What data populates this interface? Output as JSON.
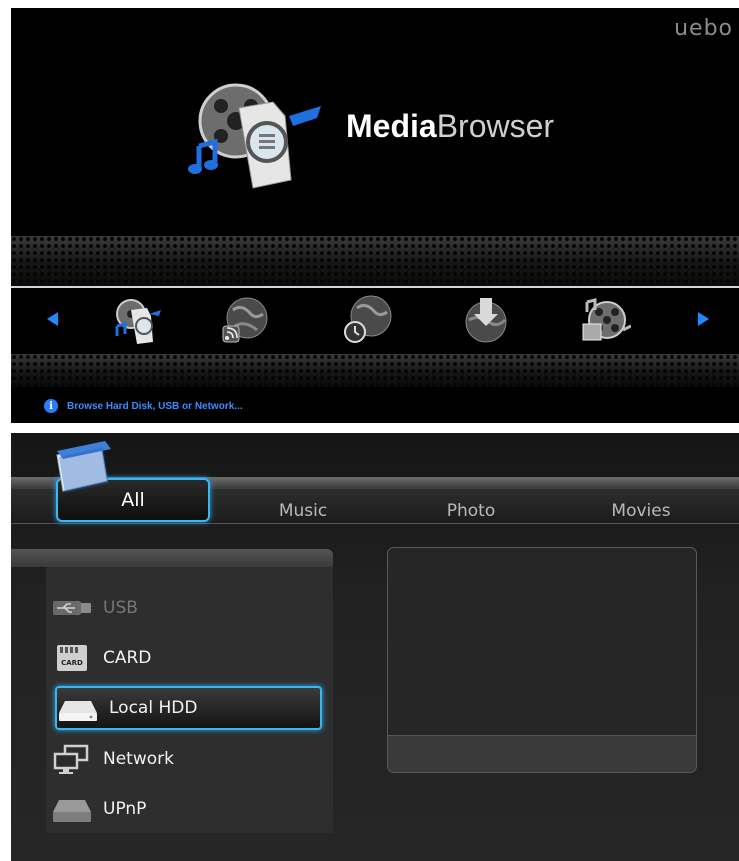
{
  "top": {
    "brand": "uebo",
    "title_bold": "Media",
    "title_light": "Browser",
    "menu_icons": [
      "media-browser-icon",
      "rss-globe-icon",
      "web-globe-icon",
      "download-globe-icon",
      "movie-music-icon"
    ],
    "info_glyph": "i",
    "info_text": "Browse Hard Disk, USB or Network..."
  },
  "bottom": {
    "tabs": [
      "All",
      "Music",
      "Photo",
      "Movies"
    ],
    "active_tab": "All",
    "devices": [
      {
        "label": "USB",
        "icon": "usb-icon",
        "state": "disabled"
      },
      {
        "label": "CARD",
        "icon": "memory-card-icon",
        "state": "normal"
      },
      {
        "label": "Local HDD",
        "icon": "hard-drive-icon",
        "state": "selected"
      },
      {
        "label": "Network",
        "icon": "network-computers-icon",
        "state": "normal"
      },
      {
        "label": "UPnP",
        "icon": "upnp-drive-icon",
        "state": "normal"
      }
    ],
    "card_icon_text": "CARD"
  },
  "colors": {
    "accent_blue": "#1e8cff",
    "focus_cyan": "#38b7f0",
    "info_text": "#3a8dff"
  }
}
